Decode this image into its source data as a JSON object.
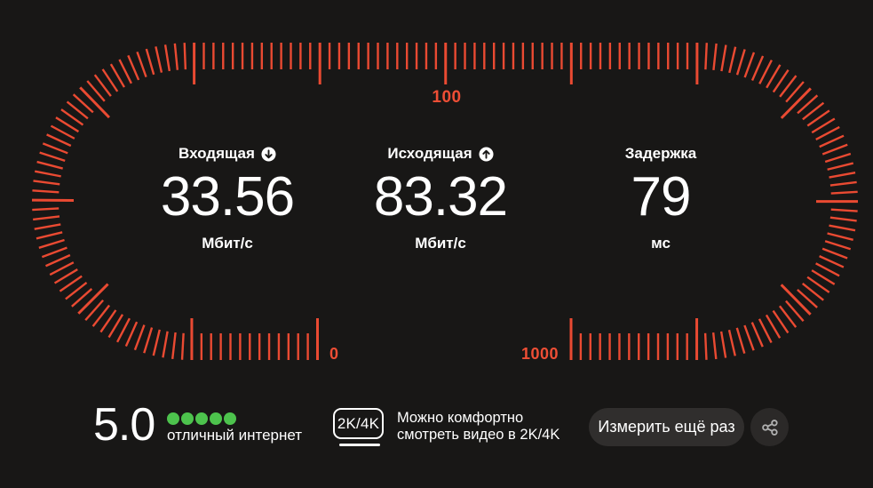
{
  "gauge": {
    "tick_color": "#ea4a32",
    "label_color": "#ee4e35",
    "scale_labels": {
      "start": "0",
      "middle": "100",
      "end": "1000"
    }
  },
  "metrics": [
    {
      "label": "Входящая",
      "icon": "download-arrow-circle-icon",
      "value": "33.56",
      "unit": "Мбит/с"
    },
    {
      "label": "Исходящая",
      "icon": "upload-arrow-circle-icon",
      "value": "83.32",
      "unit": "Мбит/с"
    },
    {
      "label": "Задержка",
      "icon": null,
      "value": "79",
      "unit": "мс"
    }
  ],
  "summary": {
    "score": "5.0",
    "dots_count": 5,
    "dot_color": "#4dc34d",
    "verdict": "отличный интернет",
    "quality_badge": "2K/4K",
    "quality_line1": "Можно комфортно",
    "quality_line2": "смотреть видео в 2K/4K"
  },
  "actions": {
    "measure_again_label": "Измерить ещё раз",
    "share_icon": "share-icon"
  }
}
